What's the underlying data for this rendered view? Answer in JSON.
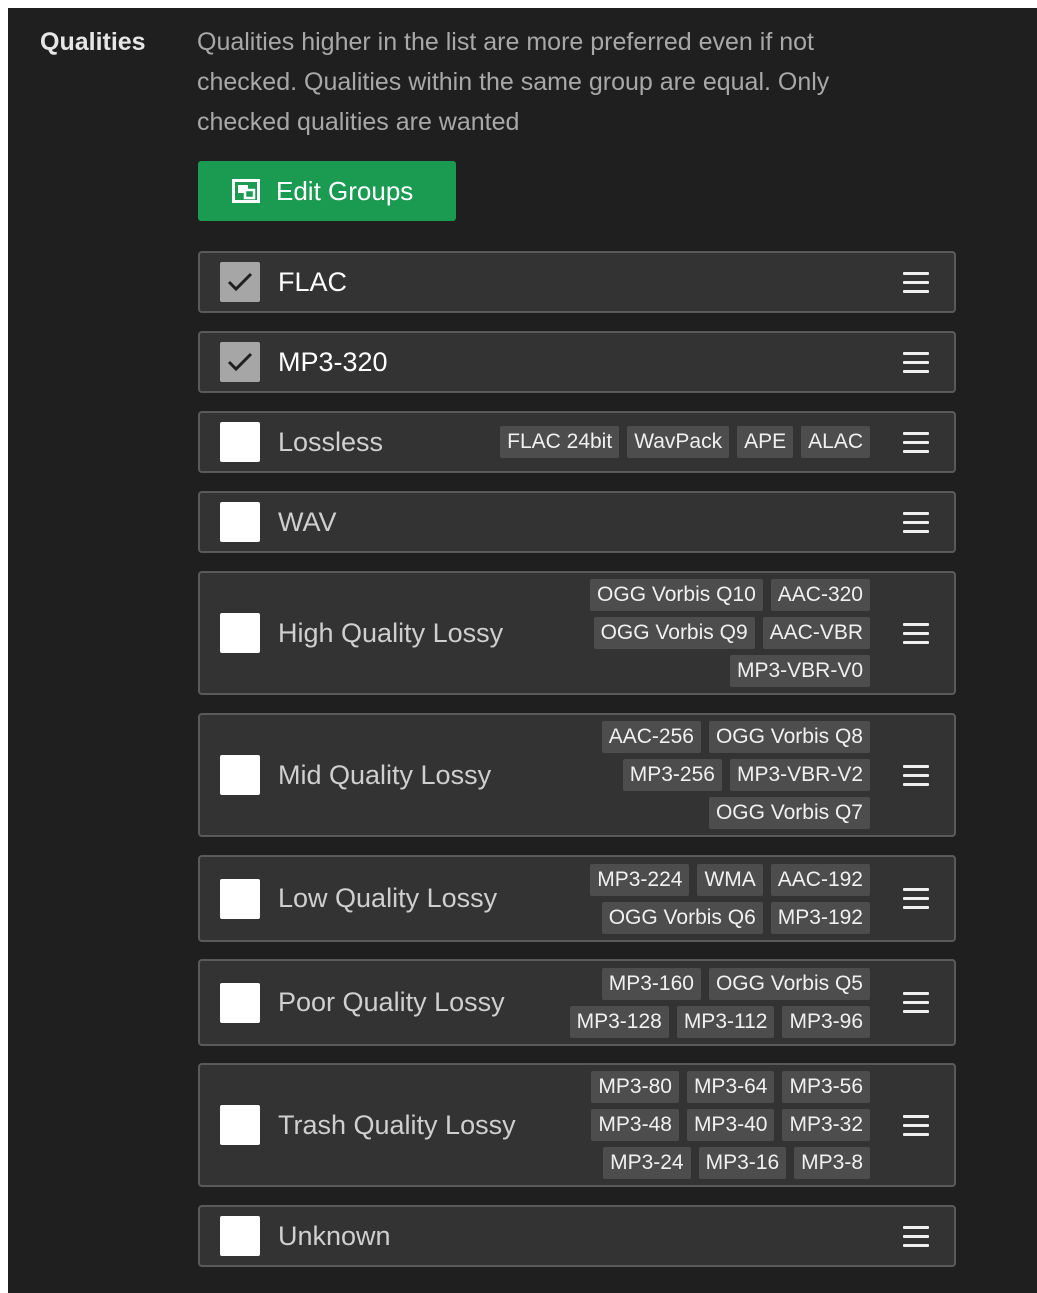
{
  "section": {
    "label": "Qualities",
    "description": "Qualities higher in the list are more preferred even if not checked. Qualities within the same group are equal. Only checked qualities are wanted"
  },
  "edit_button": {
    "label": "Edit Groups",
    "icon": "edit-groups-icon",
    "color": "#1b9a52"
  },
  "qualities": [
    {
      "name": "FLAC",
      "checked": true,
      "tags": []
    },
    {
      "name": "MP3-320",
      "checked": true,
      "tags": []
    },
    {
      "name": "Lossless",
      "checked": false,
      "tags": [
        [
          "FLAC 24bit",
          "WavPack",
          "APE",
          "ALAC"
        ]
      ]
    },
    {
      "name": "WAV",
      "checked": false,
      "tags": []
    },
    {
      "name": "High Quality Lossy",
      "checked": false,
      "tags": [
        [
          "OGG Vorbis Q10",
          "AAC-320"
        ],
        [
          "OGG Vorbis Q9",
          "AAC-VBR"
        ],
        [
          "MP3-VBR-V0"
        ]
      ]
    },
    {
      "name": "Mid Quality Lossy",
      "checked": false,
      "tags": [
        [
          "AAC-256",
          "OGG Vorbis Q8"
        ],
        [
          "MP3-256",
          "MP3-VBR-V2"
        ],
        [
          "OGG Vorbis Q7"
        ]
      ]
    },
    {
      "name": "Low Quality Lossy",
      "checked": false,
      "tags": [
        [
          "MP3-224",
          "WMA",
          "AAC-192"
        ],
        [
          "OGG Vorbis Q6",
          "MP3-192"
        ]
      ]
    },
    {
      "name": "Poor Quality Lossy",
      "checked": false,
      "tags": [
        [
          "MP3-160",
          "OGG Vorbis Q5"
        ],
        [
          "MP3-128",
          "MP3-112",
          "MP3-96"
        ]
      ]
    },
    {
      "name": "Trash Quality Lossy",
      "checked": false,
      "tags": [
        [
          "MP3-80",
          "MP3-64",
          "MP3-56"
        ],
        [
          "MP3-48",
          "MP3-40",
          "MP3-32"
        ],
        [
          "MP3-24",
          "MP3-16",
          "MP3-8"
        ]
      ]
    },
    {
      "name": "Unknown",
      "checked": false,
      "tags": []
    }
  ]
}
